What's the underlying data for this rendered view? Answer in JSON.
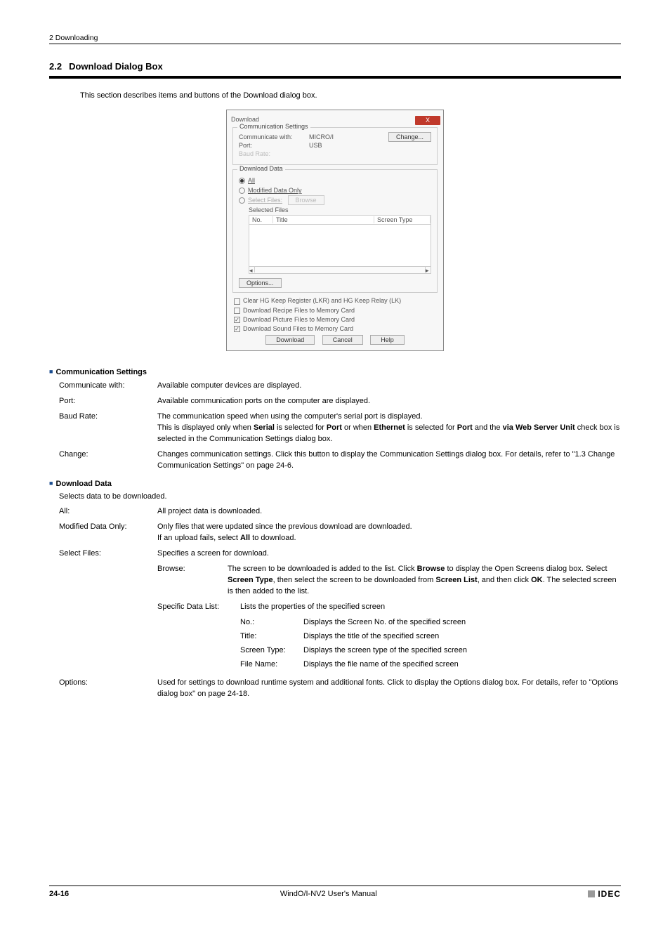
{
  "header": {
    "chapter": "2 Downloading"
  },
  "section": {
    "number": "2.2",
    "title": "Download Dialog Box",
    "intro": "This section describes items and buttons of the Download dialog box."
  },
  "dialog": {
    "title": "Download",
    "close": "X",
    "comm": {
      "legend": "Communication Settings",
      "cwLabel": "Communicate with:",
      "cwValue": "MICRO/I",
      "portLabel": "Port:",
      "portValue": "USB",
      "baudLabel": "Baud Rate:",
      "changeBtn": "Change..."
    },
    "data": {
      "legend": "Download Data",
      "all": "All",
      "modified": "Modified Data Only",
      "selectFiles": "Select Files:",
      "browseBtn": "Browse",
      "selectedFiles": "Selected Files",
      "colNo": "No.",
      "colTitle": "Title",
      "colScreenType": "Screen Type",
      "optionsBtn": "Options..."
    },
    "checks": {
      "clear": "Clear HG Keep Register (LKR) and HG Keep Relay (LK)",
      "recipe": "Download Recipe Files to Memory Card",
      "picture": "Download Picture Files to Memory Card",
      "sound": "Download Sound Files to Memory Card"
    },
    "buttons": {
      "download": "Download",
      "cancel": "Cancel",
      "help": "Help"
    }
  },
  "commSettings": {
    "heading": "Communication Settings",
    "rows": {
      "cw": {
        "label": "Communicate with:",
        "value": "Available computer devices are displayed."
      },
      "port": {
        "label": "Port:",
        "value": "Available communication ports on the computer are displayed."
      },
      "baud": {
        "label": "Baud Rate:",
        "value1": "The communication speed when using the computer's serial port is displayed.",
        "value2a": "This is displayed only when ",
        "serial": "Serial",
        "value2b": " is selected for ",
        "portb": "Port",
        "value2c": " or when ",
        "ethernet": "Ethernet",
        "value2d": " is selected for ",
        "portb2": "Port",
        "value2e": " and the ",
        "viaWeb": "via Web Server Unit",
        "value2f": " check box is selected in the Communication Settings dialog box."
      },
      "change": {
        "label": "Change:",
        "value": "Changes communication settings. Click this button to display the Communication Settings dialog box. For details, refer to \"1.3 Change Communication Settings\" on page 24-6."
      }
    }
  },
  "downloadData": {
    "heading": "Download Data",
    "subtext": "Selects data to be downloaded.",
    "rows": {
      "all": {
        "label": "All:",
        "value": "All project data is downloaded."
      },
      "modified": {
        "label": "Modified Data Only:",
        "value1": "Only files that were updated since the previous download are downloaded.",
        "value2a": "If an upload fails, select ",
        "allb": "All",
        "value2b": " to download."
      },
      "selectFiles": {
        "label": "Select Files:",
        "value": "Specifies a screen for download."
      },
      "browse": {
        "label": "Browse:",
        "v1": "The screen to be downloaded is added to the list. Click ",
        "b1": "Browse",
        "v2": " to display the Open Screens dialog box. Select ",
        "b2": "Screen Type",
        "v3": ", then select the screen to be downloaded from ",
        "b3": "Screen List",
        "v4": ", and then click ",
        "b4": "OK",
        "v5": ". The selected screen is then added to the list."
      },
      "specList": {
        "label": "Specific Data List:",
        "value": "Lists the properties of the specified screen"
      },
      "no": {
        "label": "No.:",
        "value": "Displays the Screen No. of the specified screen"
      },
      "title": {
        "label": "Title:",
        "value": "Displays the title of the specified screen"
      },
      "screenType": {
        "label": "Screen Type:",
        "value": "Displays the screen type of the specified screen"
      },
      "fileName": {
        "label": "File Name:",
        "value": "Displays the file name of the specified screen"
      },
      "options": {
        "label": "Options:",
        "value": "Used for settings to download runtime system and additional fonts. Click to display the Options dialog box. For details, refer to \"Options dialog box\" on page 24-18."
      }
    }
  },
  "footer": {
    "pageNum": "24-16",
    "manual": "WindO/I-NV2 User's Manual",
    "brand": "IDEC"
  }
}
